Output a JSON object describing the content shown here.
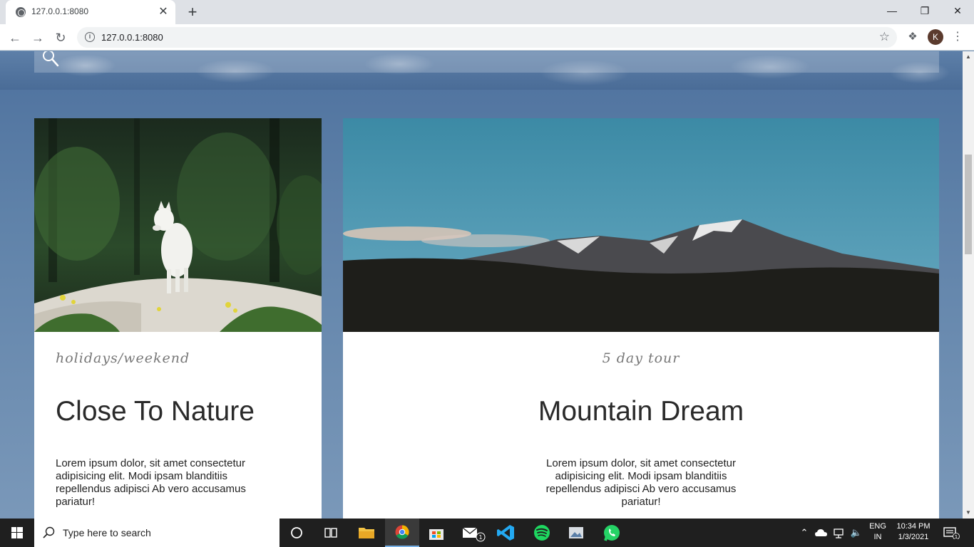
{
  "browser": {
    "tab_title": "127.0.0.1:8080",
    "tab_close": "✕",
    "new_tab": "+",
    "url": "127.0.0.1:8080",
    "profile_initial": "K",
    "window_controls": {
      "minimize": "—",
      "restore": "❐",
      "close": "✕"
    }
  },
  "page": {
    "cards": [
      {
        "category": "holidays/weekend",
        "title": "Close To Nature",
        "text": "Lorem ipsum dolor, sit amet consectetur adipisicing elit. Modi ipsam blanditiis repellendus adipisci Ab vero accusamus pariatur!"
      },
      {
        "category": "5 day tour",
        "title": "Mountain Dream",
        "text": "Lorem ipsum dolor, sit amet consectetur adipisicing elit. Modi ipsam blanditiis repellendus adipisci Ab vero accusamus pariatur!"
      }
    ]
  },
  "taskbar": {
    "search_placeholder": "Type here to search",
    "language": "ENG",
    "region": "IN",
    "time": "10:34 PM",
    "date": "1/3/2021",
    "mail_badge": "1",
    "notification_count": "1"
  },
  "colors": {
    "page_background": "#6d8fb3",
    "card_background": "#ffffff",
    "taskbar": "#1f1f1f",
    "accent": "#77b0e6"
  }
}
